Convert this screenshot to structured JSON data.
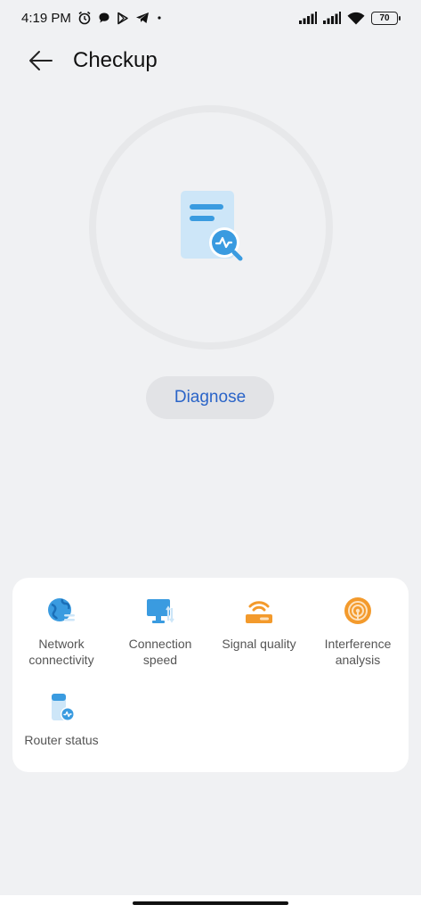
{
  "status_bar": {
    "time": "4:19 PM",
    "icons": [
      "alarm-icon",
      "chat-icon",
      "play-store-icon",
      "telegram-icon",
      "dot-icon"
    ],
    "right_icons": [
      "signal-icon",
      "signal-icon",
      "wifi-icon"
    ],
    "battery": "70"
  },
  "header": {
    "back_icon": "arrow-left-icon",
    "title": "Checkup"
  },
  "hero": {
    "icon": "document-diagnose-icon",
    "button_label": "Diagnose"
  },
  "tools": [
    {
      "label": "Network\nconnectivity",
      "icon": "globe-icon",
      "color": "#3a9be0"
    },
    {
      "label": "Connection\nspeed",
      "icon": "monitor-icon",
      "color": "#3a9be0"
    },
    {
      "label": "Signal quality",
      "icon": "router-signal-icon",
      "color": "#f39a2c"
    },
    {
      "label": "Interference\nanalysis",
      "icon": "target-icon",
      "color": "#f39a2c"
    },
    {
      "label": "Router status",
      "icon": "router-status-icon",
      "color": "#3a9be0"
    }
  ],
  "colors": {
    "accent": "#2a64c8",
    "blue_icon": "#3a9be0",
    "orange_icon": "#f39a2c",
    "background": "#f0f1f3"
  }
}
